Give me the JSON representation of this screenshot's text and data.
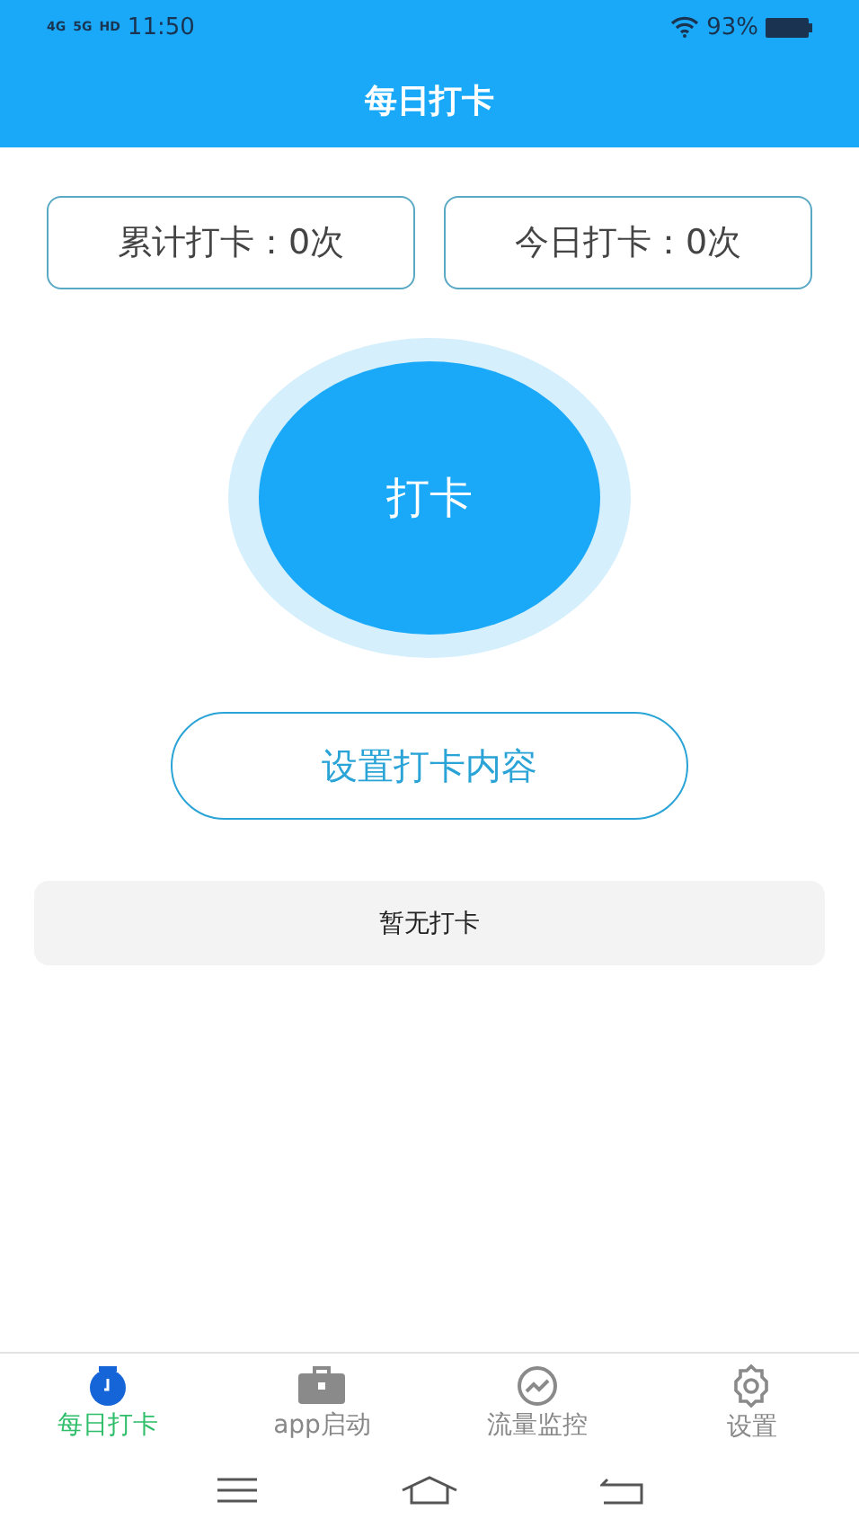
{
  "status_bar": {
    "networks": [
      "4G",
      "5G",
      "HD"
    ],
    "time": "11:50",
    "battery": "93%"
  },
  "header": {
    "title": "每日打卡"
  },
  "stats": [
    {
      "label": "累计打卡：0次"
    },
    {
      "label": "今日打卡：0次"
    }
  ],
  "punch_button": {
    "label": "打卡"
  },
  "settings_button": {
    "label": "设置打卡内容"
  },
  "records": {
    "empty_text": "暂无打卡"
  },
  "tabs": [
    {
      "label": "每日打卡",
      "kind": "clock",
      "selected": true
    },
    {
      "label": "app启动",
      "kind": "briefcase",
      "selected": false
    },
    {
      "label": "流量监控",
      "kind": "chart",
      "selected": false
    },
    {
      "label": "设置",
      "kind": "gear",
      "selected": false
    }
  ]
}
